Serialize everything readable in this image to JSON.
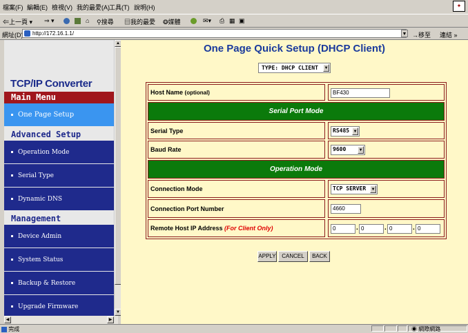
{
  "browser": {
    "menu": [
      "檔案(F)",
      "編輯(E)",
      "檢視(V)",
      "我的最愛(A)",
      "工具(T)",
      "說明(H)"
    ],
    "toolbar": {
      "back": "上一頁",
      "search": "搜尋",
      "favorites": "我的最愛",
      "media": "媒體"
    },
    "address": {
      "label": "網址(D)",
      "url": "http://172.16.1.1/",
      "go": "移至",
      "links": "連結 »"
    },
    "status": {
      "left": "完成",
      "zone": "網際網路"
    }
  },
  "sidebar": {
    "product": "TCP/IP Converter",
    "main_menu": "Main Menu",
    "one_page_setup": "One Page Setup",
    "advanced_setup": "Advanced Setup",
    "advanced_items": [
      "Operation Mode",
      "Serial Type",
      "Dynamic DNS"
    ],
    "management": "Management",
    "management_items": [
      "Device Admin",
      "System Status",
      "Backup & Restore",
      "Upgrade Firmware"
    ]
  },
  "main": {
    "title": "One Page Quick Setup (DHCP Client)",
    "type_select": "TYPE: DHCP CLIENT",
    "host_name_label": "Host Name",
    "host_name_optional": "(optional)",
    "host_name_value": "BF430",
    "serial_port_mode": "Serial Port Mode",
    "serial_type_label": "Serial Type",
    "serial_type_value": "RS485",
    "baud_rate_label": "Baud Rate",
    "baud_rate_value": "9600",
    "operation_mode": "Operation Mode",
    "connection_mode_label": "Connection Mode",
    "connection_mode_value": "TCP SERVER",
    "connection_port_label": "Connection Port Number",
    "connection_port_value": "4660",
    "remote_host_label": "Remote Host  IP Address",
    "remote_host_note": "(For Client Only)",
    "remote_ip": [
      "0",
      "0",
      "0",
      "0"
    ],
    "buttons": {
      "apply": "APPLY",
      "cancel": "CANCEL",
      "back": "BACK"
    }
  },
  "colors": {
    "sidebar_blue": "#1f2a8c",
    "section_green": "#0b7a0b",
    "page_bg": "#fff8c8",
    "main_menu_red": "#a0161c",
    "active_item": "#3a95f0"
  }
}
